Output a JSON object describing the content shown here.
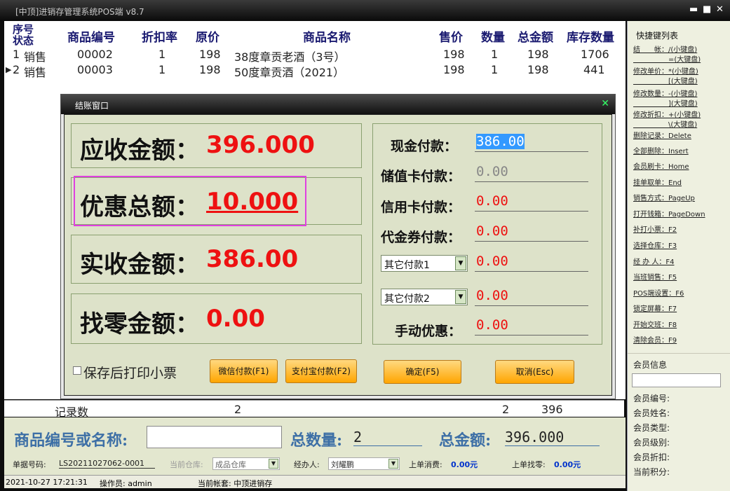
{
  "window": {
    "title": "[中顶]进销存管理系统POS端 v8.7",
    "min": "▬",
    "max": "■",
    "close": "✕"
  },
  "grid": {
    "headers": [
      "序号",
      "状态",
      "商品编号",
      "折扣率",
      "原价",
      "商品名称",
      "售价",
      "数量",
      "总金额",
      "库存数量"
    ],
    "rows": [
      {
        "no": "1",
        "status": "销售",
        "code": "00002",
        "discount": "1",
        "price": "198",
        "name": "38度章贡老酒（3号）",
        "sale": "198",
        "qty": "1",
        "total": "198",
        "stock": "1706"
      },
      {
        "no": "2",
        "status": "销售",
        "code": "00003",
        "discount": "1",
        "price": "198",
        "name": "50度章贡酒（2021）",
        "sale": "198",
        "qty": "1",
        "total": "198",
        "stock": "441"
      }
    ],
    "footer": {
      "label": "记录数",
      "count": "2",
      "qty": "2",
      "total": "396"
    }
  },
  "dialog": {
    "title": "结账窗口",
    "receivable_label": "应收金额：",
    "receivable": "396.000",
    "discount_label": "优惠总额：",
    "discount": "10.000",
    "actual_label": "实收金额：",
    "actual": "386.00",
    "change_label": "找零金额：",
    "change": "0.00",
    "payments": [
      {
        "label": "现金付款：",
        "value": "386.00"
      },
      {
        "label": "储值卡付款：",
        "value": "0.00"
      },
      {
        "label": "信用卡付款：",
        "value": "0.00"
      },
      {
        "label": "代金券付款：",
        "value": "0.00"
      }
    ],
    "other1": {
      "option": "其它付款1",
      "value": "0.00"
    },
    "other2": {
      "option": "其它付款2",
      "value": "0.00"
    },
    "manual_label": "手动优惠：",
    "manual": "0.00",
    "print_label": "保存后打印小票",
    "wechat": "微信付款(F1)",
    "alipay": "支付宝付款(F2)",
    "ok": "确定(F5)",
    "cancel": "取消(Esc)"
  },
  "shortcuts": {
    "title": "快捷键列表",
    "items": [
      "结　　帐：/(小键盘)",
      "　　　　　=(大键盘)",
      "修改单价：*(小键盘)",
      "　　　　　[(大键盘)",
      "修改数量：-(小键盘)",
      "　　　　　](大键盘)",
      "修改折扣：+(小键盘)",
      "　　　　　\\(大键盘)",
      "删除记录：Delete",
      "全部删除：Insert",
      "会员刷卡：Home",
      "挂单取单：End",
      "销售方式：PageUp",
      "打开钱箱：PageDown",
      "补打小票：F2",
      "选择仓库：F3",
      "经 办 人：F4",
      "当班销售：F5",
      "POS端设置：F6",
      "锁定屏幕：F7",
      "开始交班：F8",
      "清除会员：F9"
    ]
  },
  "member": {
    "title": "会员信息",
    "fields": [
      "会员编号:",
      "会员姓名:",
      "会员类型:",
      "会员级别:",
      "会员折扣:",
      "当前积分:"
    ]
  },
  "bottom": {
    "search_label": "商品编号或名称:",
    "total_qty_label": "总数量:",
    "total_qty": "2",
    "total_amt_label": "总金额:",
    "total_amt": "396.000",
    "order_label": "单据号码:",
    "order_no": "LS20211027062-0001",
    "warehouse_label": "当前仓库:",
    "warehouse": "成品仓库",
    "handler_label": "经办人:",
    "handler": "刘耀鹏",
    "last_spend_label": "上单消费:",
    "last_spend": "0.00元",
    "last_change_label": "上单找零:",
    "last_change": "0.00元"
  },
  "status": {
    "datetime": "2021-10-27 17:21:31",
    "operator": "操作员: admin",
    "account": "当前帐套: 中顶进销存"
  }
}
